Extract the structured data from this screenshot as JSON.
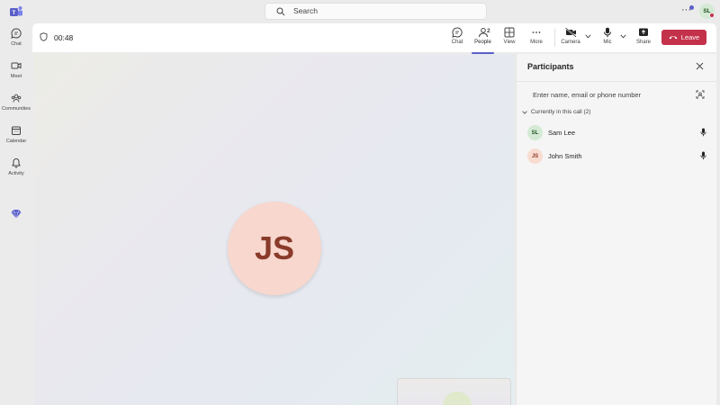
{
  "topbar": {
    "search_placeholder": "Search",
    "more_label": "···",
    "user_initials": "SL"
  },
  "rail": {
    "items": [
      {
        "label": "Chat",
        "icon": "chat-icon"
      },
      {
        "label": "Meet",
        "icon": "video-icon"
      },
      {
        "label": "Communities",
        "icon": "communities-icon"
      },
      {
        "label": "Calendar",
        "icon": "calendar-icon"
      },
      {
        "label": "Activity",
        "icon": "bell-icon"
      }
    ],
    "premium_icon": "diamond-icon"
  },
  "meeting": {
    "timer": "00:48",
    "controls": {
      "chat": "Chat",
      "people": "People",
      "people_count": "2",
      "view": "View",
      "more": "More",
      "camera": "Camera",
      "mic": "Mic",
      "share": "Share",
      "leave": "Leave"
    }
  },
  "stage": {
    "main_avatar_initials": "JS",
    "main_avatar_color": "#f7d7ce"
  },
  "participants_panel": {
    "title": "Participants",
    "search_placeholder": "Enter name, email or phone number",
    "section_label": "Currently in this call (2)",
    "participants": [
      {
        "initials": "SL",
        "name": "Sam Lee",
        "avatar_bg": "#d4ead4",
        "avatar_fg": "#225222"
      },
      {
        "initials": "JS",
        "name": "John Smith",
        "avatar_bg": "#f9dcd1",
        "avatar_fg": "#8a3b2a"
      }
    ]
  },
  "colors": {
    "accent": "#5b5fc7",
    "leave": "#c4314b"
  }
}
